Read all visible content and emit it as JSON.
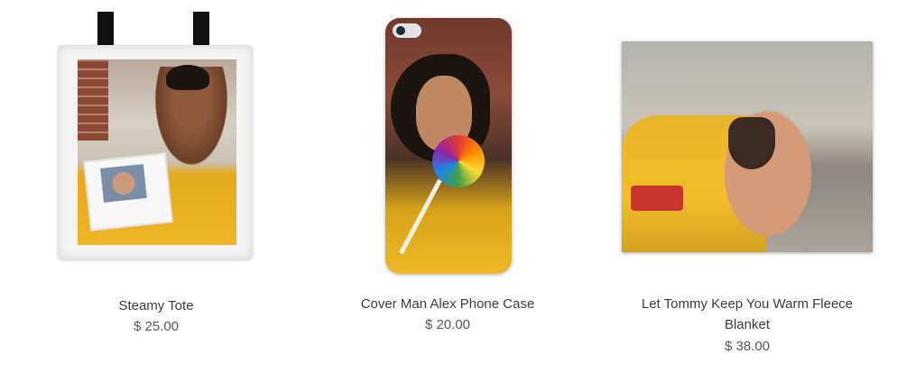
{
  "products": [
    {
      "title": "Steamy Tote",
      "price": "$ 25.00"
    },
    {
      "title": "Cover Man Alex Phone Case",
      "price": "$ 20.00"
    },
    {
      "title_line1": "Let Tommy Keep You Warm Fleece",
      "title_line2": "Blanket",
      "price": "$ 38.00"
    }
  ],
  "colors": {
    "text": "#3b3b3b",
    "taxi_yellow": "#f0b526",
    "background": "#ffffff"
  }
}
